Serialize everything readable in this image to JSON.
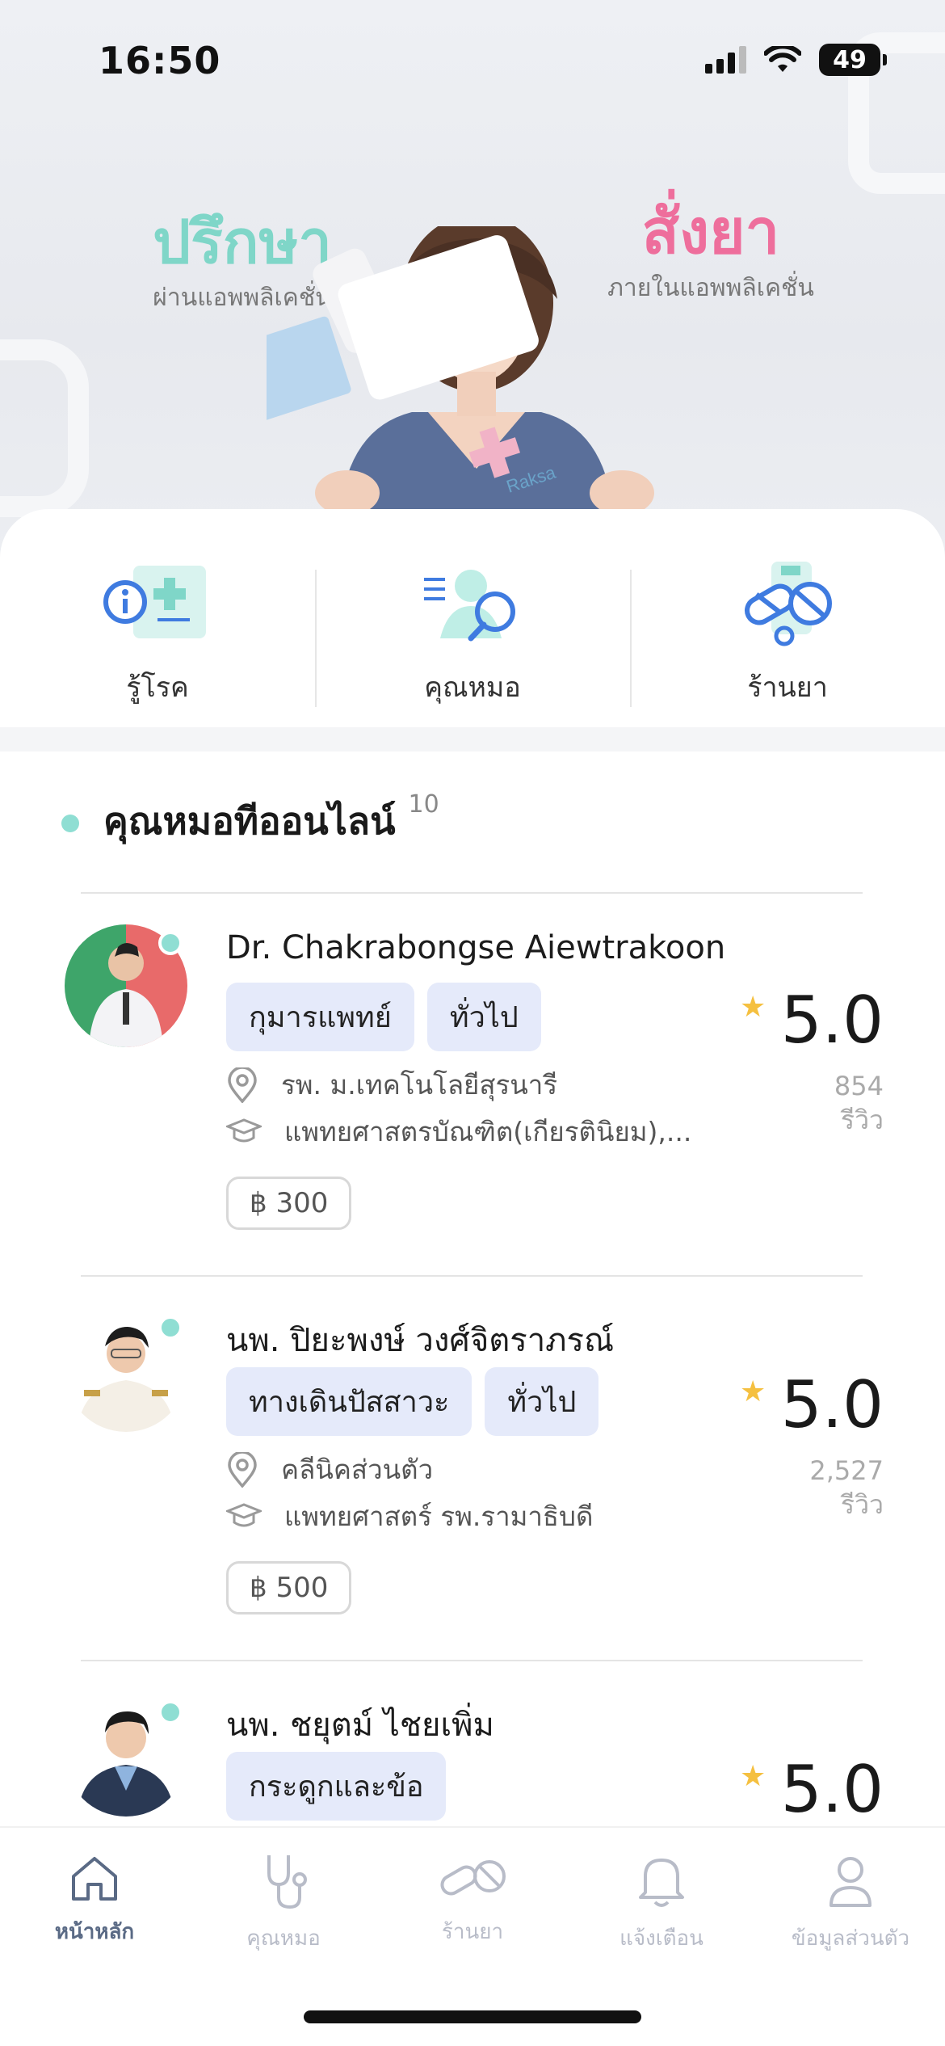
{
  "status_bar": {
    "time": "16:50",
    "battery": "49"
  },
  "hero": {
    "left_title": "ปรึกษา",
    "left_subtitle": "ผ่านแอพพลิเคชั่น",
    "right_title": "สั่งยา",
    "right_subtitle": "ภายในแอพพลิเคชั่น",
    "box_brand": "Raksa"
  },
  "quick_actions": [
    {
      "label": "รู้โรค",
      "icon": "disease-info-icon"
    },
    {
      "label": "คุณหมอ",
      "icon": "doctor-search-icon"
    },
    {
      "label": "ร้านยา",
      "icon": "pharmacy-pills-icon"
    }
  ],
  "section": {
    "title": "คุณหมอทีออนไลน์",
    "count": "10"
  },
  "doctors": [
    {
      "name": "Dr. Chakrabongse Aiewtrakoon",
      "tags": [
        "กุมารแพทย์",
        "ทั่วไป"
      ],
      "hospital": "รพ. ม.เทคโนโลยีสุรนารี",
      "education": "แพทยศาสตรบัณฑิต(เกียรตินิยม),...",
      "price": "฿ 300",
      "rating": "5.0",
      "reviews": "854",
      "reviews_label": "รีวิว"
    },
    {
      "name": "นพ. ปิยะพงษ์ วงศ์จิตราภรณ์",
      "tags": [
        "ทางเดินปัสสาวะ",
        "ทั่วไป"
      ],
      "hospital": "คลีนิคส่วนตัว",
      "education": "แพทยศาสตร์ รพ.รามาธิบดี",
      "price": "฿ 500",
      "rating": "5.0",
      "reviews": "2,527",
      "reviews_label": "รีวิว"
    },
    {
      "name": "นพ. ชยุตม์ ไชยเพิ่ม",
      "tags": [
        "กระดูกและข้อ"
      ],
      "rating": "5.0"
    }
  ],
  "tabbar": [
    {
      "label": "หน้าหลัก",
      "icon": "home-icon",
      "active": true
    },
    {
      "label": "คุณหมอ",
      "icon": "stethoscope-icon",
      "active": false
    },
    {
      "label": "ร้านยา",
      "icon": "pills-icon",
      "active": false
    },
    {
      "label": "แจ้งเตือน",
      "icon": "bell-icon",
      "active": false
    },
    {
      "label": "ข้อมูลส่วนตัว",
      "icon": "profile-icon",
      "active": false
    }
  ],
  "colors": {
    "accent_teal": "#7fd6c8",
    "accent_pink": "#ee6e9c",
    "tag_bg": "#e5eafa",
    "star": "#f5c040"
  }
}
